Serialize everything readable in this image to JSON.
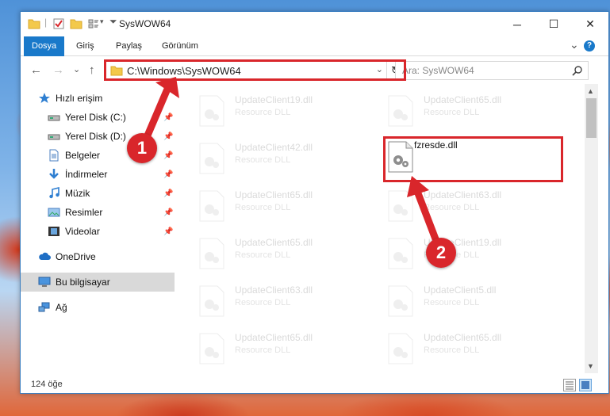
{
  "window": {
    "title": "SysWOW64",
    "min_glyph": "─",
    "max_glyph": "☐",
    "close_glyph": "✕"
  },
  "ribbon": {
    "tabs": [
      {
        "label": "Dosya",
        "active": true
      },
      {
        "label": "Giriş",
        "active": false
      },
      {
        "label": "Paylaş",
        "active": false
      },
      {
        "label": "Görünüm",
        "active": false
      }
    ],
    "expand_glyph": "⌄",
    "help_glyph": "?"
  },
  "nav": {
    "back_glyph": "←",
    "forward_glyph": "→",
    "recent_glyph": "⌄",
    "up_glyph": "↑",
    "address": "C:\\Windows\\SysWOW64",
    "address_dropdown_glyph": "⌄",
    "refresh_glyph": "↻",
    "search_placeholder": "Ara: SysWOW64"
  },
  "sidebar": {
    "items": [
      {
        "label": "Hızlı erişim",
        "icon": "star-icon",
        "pinned": false,
        "selected": false
      },
      {
        "label": "Yerel Disk (C:)",
        "icon": "drive-icon",
        "pinned": true,
        "selected": false
      },
      {
        "label": "Yerel Disk (D:)",
        "icon": "drive-icon",
        "pinned": true,
        "selected": false
      },
      {
        "label": "Belgeler",
        "icon": "documents-icon",
        "pinned": true,
        "selected": false
      },
      {
        "label": "İndirmeler",
        "icon": "download-icon",
        "pinned": true,
        "selected": false
      },
      {
        "label": "Müzik",
        "icon": "music-icon",
        "pinned": true,
        "selected": false
      },
      {
        "label": "Resimler",
        "icon": "pictures-icon",
        "pinned": true,
        "selected": false
      },
      {
        "label": "Videolar",
        "icon": "videos-icon",
        "pinned": true,
        "selected": false
      },
      {
        "label": "OneDrive",
        "icon": "cloud-icon",
        "pinned": false,
        "selected": false
      },
      {
        "label": "Bu bilgisayar",
        "icon": "computer-icon",
        "pinned": false,
        "selected": true
      },
      {
        "label": "Ağ",
        "icon": "network-icon",
        "pinned": false,
        "selected": false
      }
    ],
    "pin_glyph": "📌"
  },
  "files": [
    {
      "name": "UpdateClient19.dll",
      "desc": "Resource DLL",
      "highlighted": false
    },
    {
      "name": "UpdateClient65.dll",
      "desc": "Resource DLL",
      "highlighted": false
    },
    {
      "name": "UpdateClient42.dll",
      "desc": "Resource DLL",
      "highlighted": false
    },
    {
      "name": "fzresde.dll",
      "desc": "",
      "highlighted": true
    },
    {
      "name": "UpdateClient65.dll",
      "desc": "Resource DLL",
      "highlighted": false
    },
    {
      "name": "UpdateClient63.dll",
      "desc": "Resource DLL",
      "highlighted": false
    },
    {
      "name": "UpdateClient65.dll",
      "desc": "Resource DLL",
      "highlighted": false
    },
    {
      "name": "UpdateClient19.dll",
      "desc": "Resource DLL",
      "highlighted": false
    },
    {
      "name": "UpdateClient63.dll",
      "desc": "Resource DLL",
      "highlighted": false
    },
    {
      "name": "UpdateClient5.dll",
      "desc": "Resource DLL",
      "highlighted": false
    },
    {
      "name": "UpdateClient65.dll",
      "desc": "Resource DLL",
      "highlighted": false
    },
    {
      "name": "UpdateClient65.dll",
      "desc": "Resource DLL",
      "highlighted": false
    }
  ],
  "status": {
    "item_count": "124 öğe"
  },
  "annotations": {
    "step1": "1",
    "step2": "2",
    "color": "#d9262b"
  },
  "colors": {
    "accent": "#1979ca",
    "annotation_red": "#d9262b",
    "selection_gray": "#d9d9d9"
  }
}
